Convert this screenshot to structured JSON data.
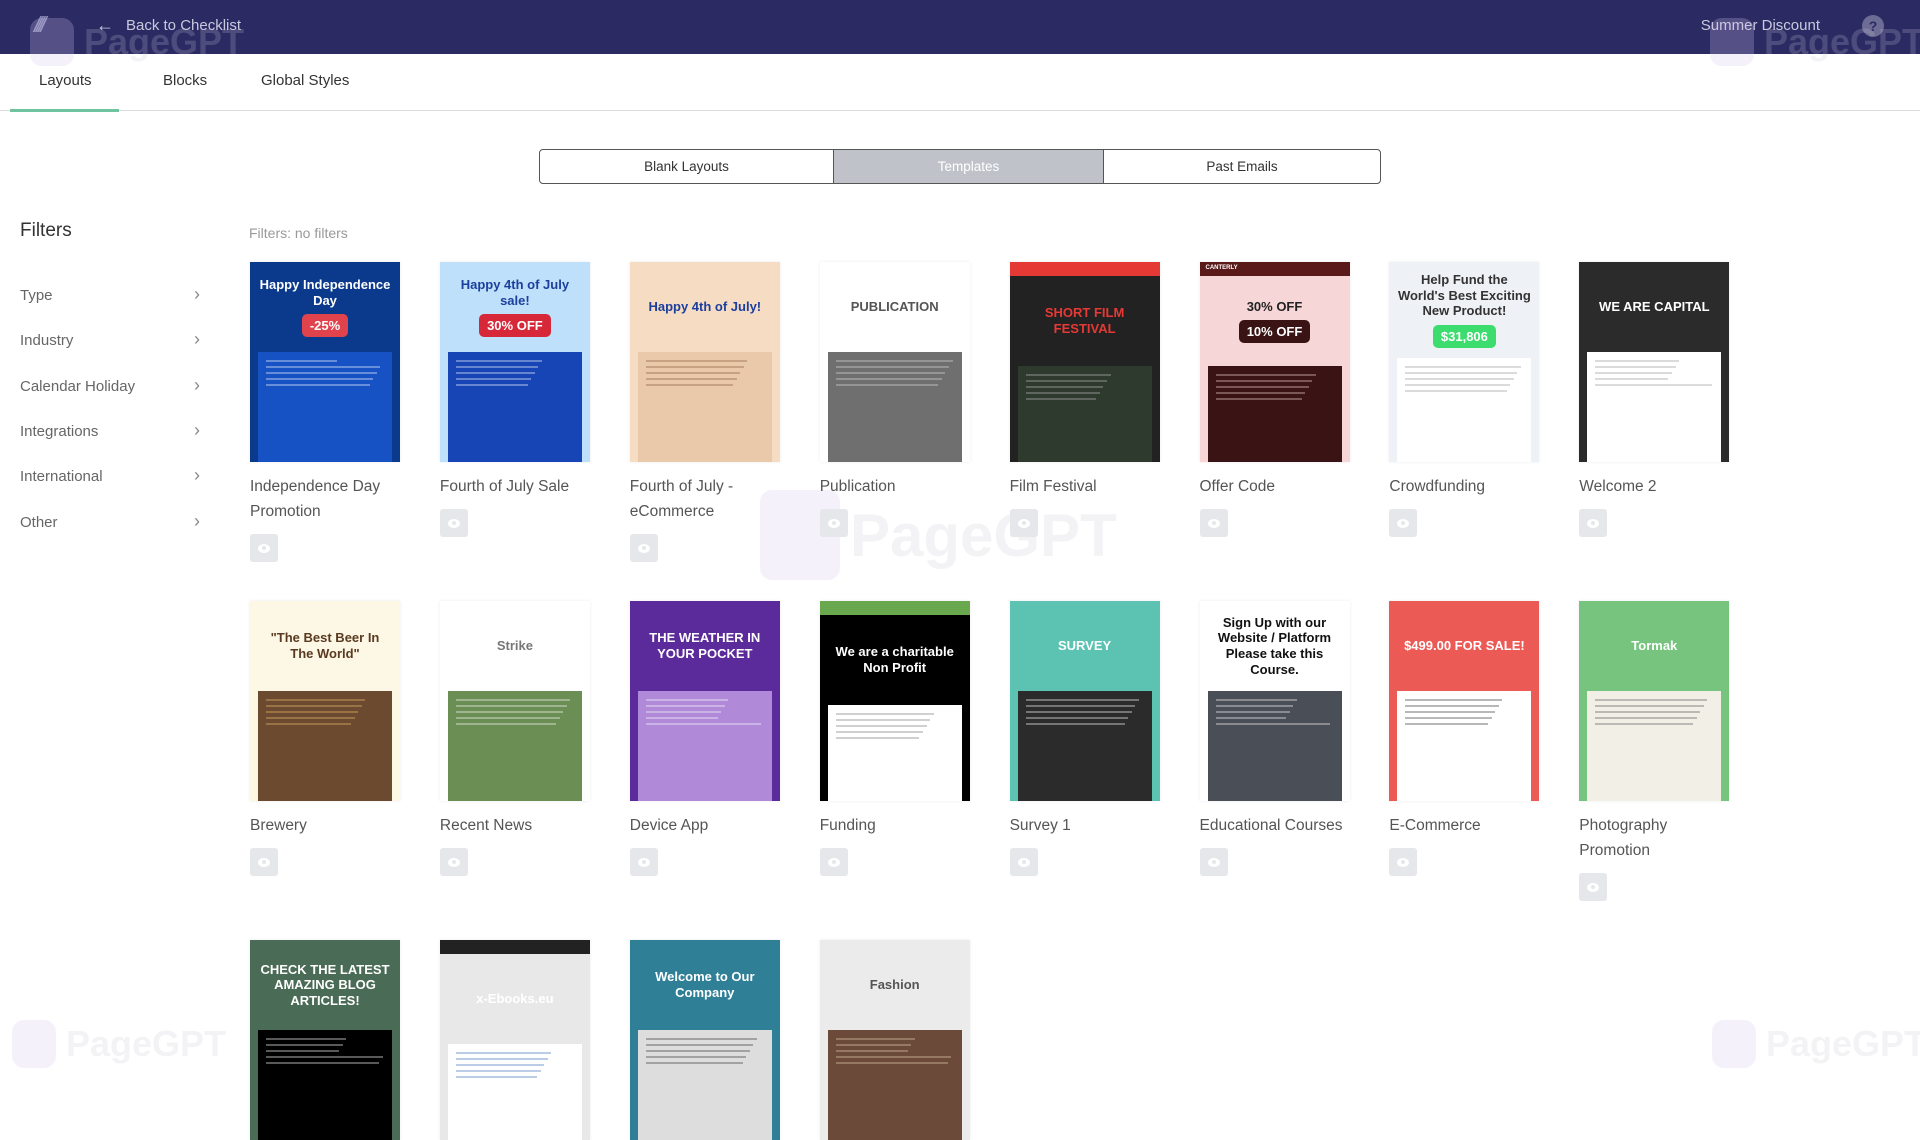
{
  "header": {
    "back_label": "Back to Checklist",
    "campaign_name": "Summer Discount",
    "help_label": "?",
    "colors": {
      "bar": "#2b2a63"
    },
    "watermark": "PageGPT"
  },
  "tabs": [
    {
      "label": "Layouts",
      "active": true
    },
    {
      "label": "Blocks",
      "active": false
    },
    {
      "label": "Global Styles",
      "active": false
    }
  ],
  "segments": [
    {
      "label": "Blank Layouts",
      "active": false
    },
    {
      "label": "Templates",
      "active": true
    },
    {
      "label": "Past Emails",
      "active": false
    }
  ],
  "filters": {
    "title": "Filters",
    "status": "Filters: no filters",
    "items": [
      "Type",
      "Industry",
      "Calendar Holiday",
      "Integrations",
      "International",
      "Other"
    ]
  },
  "templates": [
    {
      "title": "Independence Day Promotion",
      "thumb": {
        "bg": "#0b3a8c",
        "headline": "Happy Independence Day",
        "color": "#ffffff",
        "badge": "-25%",
        "badge_bg": "#e0434b",
        "lower": "#1652c4",
        "lower_fg": "#ffffff"
      }
    },
    {
      "title": "Fourth of July Sale",
      "thumb": {
        "bg": "#bfe0fb",
        "headline": "Happy 4th of July sale!",
        "color": "#1c3f9e",
        "badge": "30% OFF",
        "badge_bg": "#d62839",
        "lower": "#1745b5",
        "lower_fg": "#ffffff"
      }
    },
    {
      "title": "Fourth of July - eCommerce",
      "thumb": {
        "bg": "#f6dcc3",
        "headline": "Happy 4th of July!",
        "color": "#1c3f9e",
        "lower": "#e9c9a9",
        "lower_fg": "#8a5a3a"
      }
    },
    {
      "title": "Publication",
      "thumb": {
        "bg": "#ffffff",
        "headline": "PUBLICATION",
        "color": "#555555",
        "lower": "#6f6f6f",
        "lower_fg": "#dddddd"
      }
    },
    {
      "title": "Film Festival",
      "thumb": {
        "bg": "#222222",
        "top": "#e53935",
        "headline": "SHORT FILM FESTIVAL",
        "color": "#e53935",
        "lower": "#2f3a2e",
        "lower_fg": "#bbbbbb"
      }
    },
    {
      "title": "Offer Code",
      "thumb": {
        "bg": "#f6d6d6",
        "top": "#5a1a1a",
        "top_text": "CANTERLY",
        "headline": "30% OFF",
        "color": "#222222",
        "badge": "10% OFF",
        "badge_bg": "#3a1414",
        "lower": "#3a1414",
        "lower_fg": "#f6d6d6"
      }
    },
    {
      "title": "Crowdfunding",
      "thumb": {
        "bg": "#eef2f6",
        "headline": "Help Fund the World's Best Exciting New Product!",
        "color": "#333333",
        "badge": "$31,806",
        "badge_bg": "#3ddc6e",
        "lower": "#ffffff",
        "lower_fg": "#999999"
      }
    },
    {
      "title": "Welcome 2",
      "thumb": {
        "bg": "#2b2b2b",
        "headline": "WE ARE CAPITAL",
        "color": "#ffffff",
        "lower": "#ffffff",
        "lower_fg": "#999999"
      }
    },
    {
      "title": "Brewery",
      "thumb": {
        "bg": "#fdf8e6",
        "headline": "\"The Best Beer In The World\"",
        "color": "#5a3a20",
        "lower": "#6b4a30",
        "lower_fg": "#f0c070"
      }
    },
    {
      "title": "Recent News",
      "thumb": {
        "bg": "#ffffff",
        "headline": "Strike",
        "color": "#777777",
        "lower": "#6b8e55",
        "lower_fg": "#ffffff"
      }
    },
    {
      "title": "Device App",
      "thumb": {
        "bg": "#5b2a9b",
        "headline": "THE WEATHER IN YOUR POCKET",
        "color": "#ffffff",
        "lower": "#b08ad8",
        "lower_fg": "#ffffff"
      }
    },
    {
      "title": "Funding",
      "thumb": {
        "bg": "#000000",
        "top": "#6aa84f",
        "headline": "We are a charitable Non Profit",
        "color": "#ffffff",
        "lower": "#ffffff",
        "lower_fg": "#777777"
      }
    },
    {
      "title": "Survey 1",
      "thumb": {
        "bg": "#5cc3b3",
        "headline": "SURVEY",
        "color": "#ffffff",
        "lower": "#2b2b2b",
        "lower_fg": "#ffffff"
      }
    },
    {
      "title": "Educational Courses",
      "thumb": {
        "bg": "#ffffff",
        "headline": "Sign Up with our Website / Platform Please take this Course.",
        "color": "#111111",
        "lower": "#4a4e57",
        "lower_fg": "#ffffff"
      }
    },
    {
      "title": "E-Commerce",
      "thumb": {
        "bg": "#ec5a56",
        "headline": "$499.00 FOR SALE!",
        "color": "#ffffff",
        "lower": "#ffffff",
        "lower_fg": "#333333"
      }
    },
    {
      "title": "Photography Promotion",
      "thumb": {
        "bg": "#76c47e",
        "headline": "Tormak",
        "color": "#ffffff",
        "lower": "#f2efe6",
        "lower_fg": "#555555"
      }
    },
    {
      "title": "",
      "thumb": {
        "bg": "#4a6b55",
        "headline": "CHECK THE LATEST AMAZING BLOG ARTICLES!",
        "color": "#ffffff",
        "lower": "#000000",
        "lower_fg": "#ffffff"
      }
    },
    {
      "title": "",
      "thumb": {
        "bg": "#e8e8e8",
        "top": "#222222",
        "headline": "x-Ebooks.eu",
        "color": "#ffffff",
        "badge_bg": "#444444",
        "lower": "#ffffff",
        "lower_fg": "#3b6fb6"
      }
    },
    {
      "title": "",
      "thumb": {
        "bg": "#2f7f96",
        "headline": "Welcome to Our Company",
        "color": "#ffffff",
        "lower": "#dddddd",
        "lower_fg": "#333333"
      }
    },
    {
      "title": "",
      "thumb": {
        "bg": "#ebebeb",
        "headline": "Fashion",
        "color": "#555555",
        "lower": "#6b4a3a",
        "lower_fg": "#e8d0b0"
      }
    }
  ]
}
